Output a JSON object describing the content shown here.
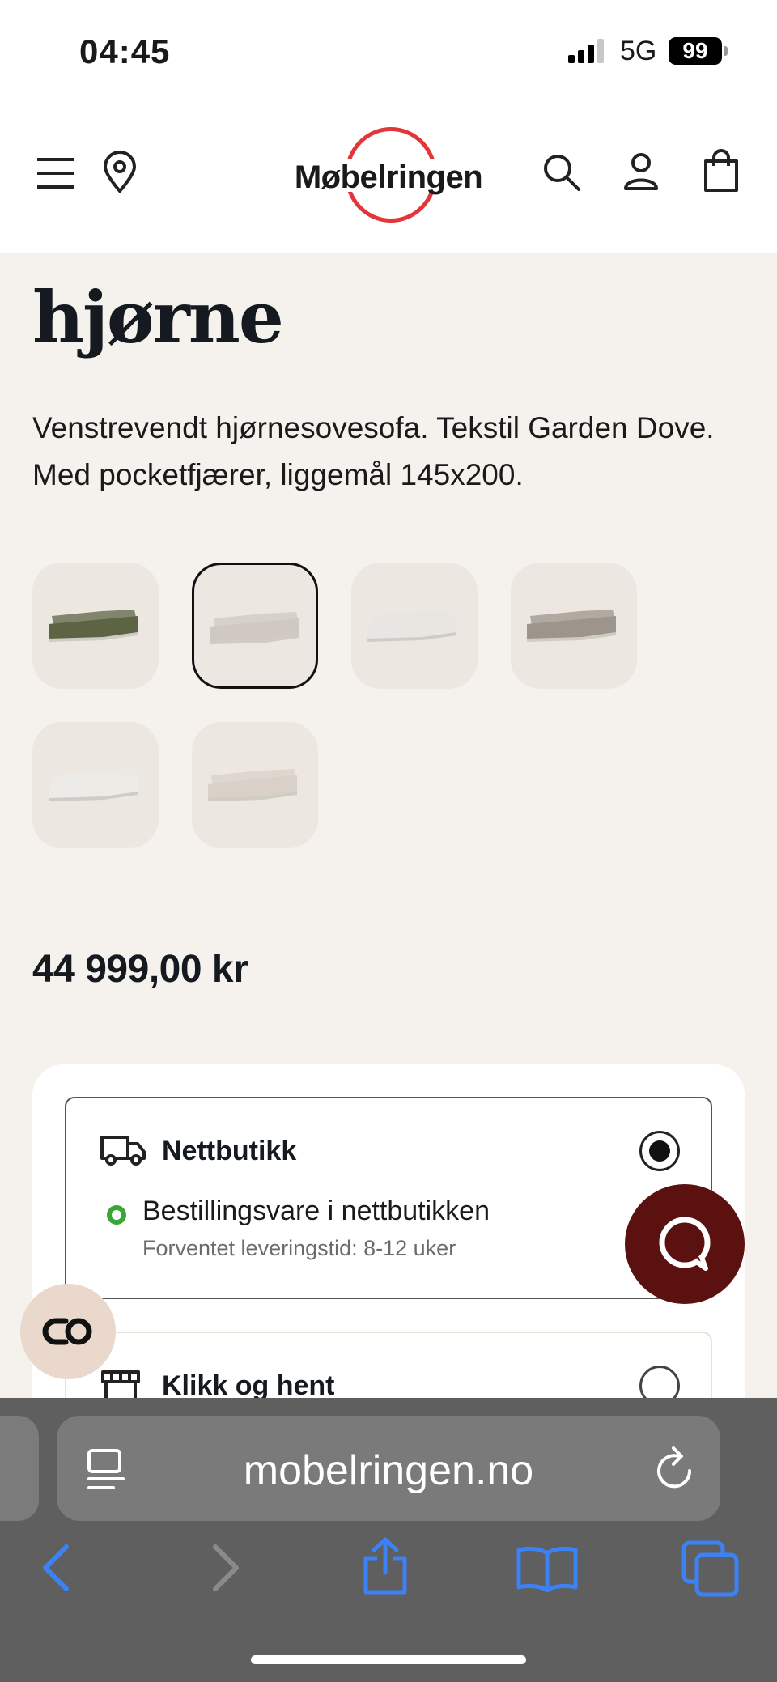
{
  "status_bar": {
    "time": "04:45",
    "network": "5G",
    "battery": "99"
  },
  "header": {
    "brand": "Møbelringen",
    "icons": [
      "menu-icon",
      "location-pin-icon",
      "search-icon",
      "user-icon",
      "shopping-bag-icon"
    ]
  },
  "product": {
    "title": "hjørne",
    "description": "Venstrevendt hjørnesovesofa. Tekstil Garden Dove. Med pocketfjærer, liggemål 145x200.",
    "price": "44 999,00 kr",
    "swatch_colors": [
      "#5d6443",
      "#cfc9c2",
      "#e8e6e2",
      "#9d958b",
      "#ecebe8",
      "#d9d1c8"
    ],
    "selected_swatch": 1
  },
  "delivery": {
    "options": [
      {
        "label": "Nettbutikk",
        "selected": true,
        "stock_text": "Bestillingsvare i nettbutikken",
        "lead_time": "Forventet leveringstid: 8-12 uker"
      },
      {
        "label": "Klikk og hent",
        "selected": false
      }
    ]
  },
  "colors": {
    "brand_red": "#e1373a",
    "chat_button": "#5c1111",
    "stock_green": "#3aa635",
    "page_bg": "#f5f2ee"
  },
  "browser": {
    "url": "mobelringen.no"
  }
}
